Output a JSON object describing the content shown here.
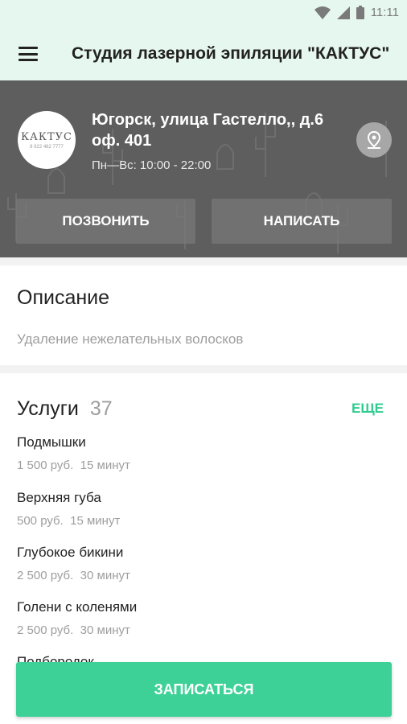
{
  "status_bar": {
    "time": "11:11"
  },
  "app_bar": {
    "title": "Студия лазерной эпиляции \"КАКТУС\""
  },
  "header": {
    "logo_text": "КАКТУС",
    "logo_sub": "8 922 462 7777",
    "address": "Югорск, улица Гастелло,, д.6 оф. 401",
    "hours": "Пн—Вс: 10:00 - 22:00",
    "call_label": "ПОЗВОНИТЬ",
    "write_label": "НАПИСАТЬ"
  },
  "description": {
    "title": "Описание",
    "text": "Удаление нежелательных волосков"
  },
  "services": {
    "title": "Услуги",
    "count": "37",
    "more_label": "ЕЩЕ",
    "items": [
      {
        "name": "Подмышки",
        "price": "1 500 руб.",
        "duration": "15 минут"
      },
      {
        "name": "Верхняя губа",
        "price": "500 руб.",
        "duration": "15 минут"
      },
      {
        "name": "Глубокое бикини",
        "price": "2 500 руб.",
        "duration": "30 минут"
      },
      {
        "name": "Голени с коленями",
        "price": "2 500 руб.",
        "duration": "30 минут"
      },
      {
        "name": "Подбородок"
      }
    ]
  },
  "cta": {
    "label": "ЗАПИСАТЬСЯ"
  },
  "colors": {
    "accent": "#3ed197",
    "appbar": "#e6f7ef",
    "more": "#2ecc8f"
  }
}
